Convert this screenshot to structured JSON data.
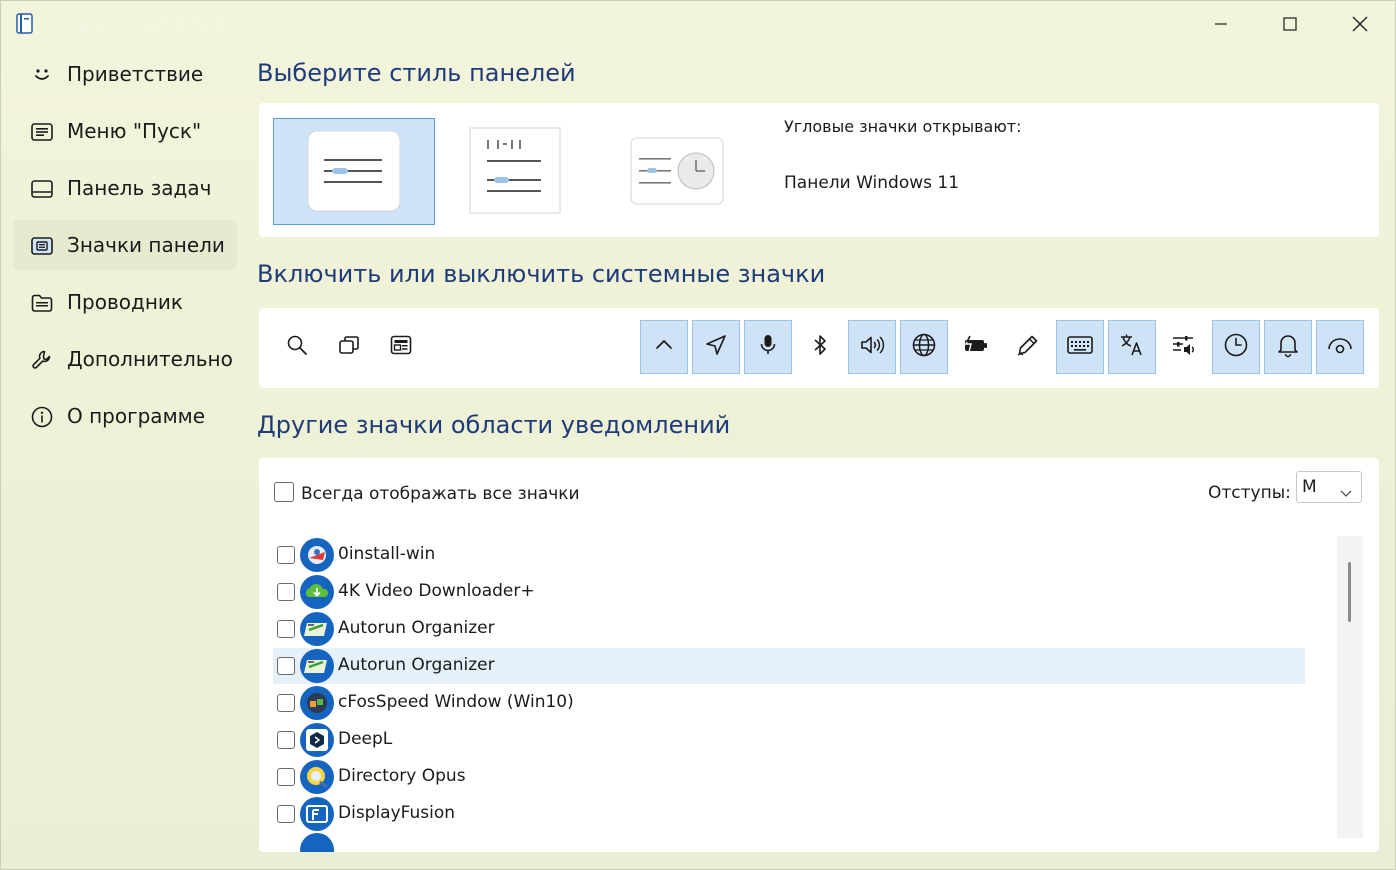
{
  "window": {
    "title": "Настройки StartAllBack",
    "controls": {
      "minimize": "minimize-icon",
      "maximize": "maximize-icon",
      "close": "close-icon"
    }
  },
  "sidebar": {
    "items": [
      {
        "label": "Приветствие",
        "icon": "smile-icon",
        "active": false
      },
      {
        "label": "Меню \"Пуск\"",
        "icon": "start-menu-icon",
        "active": false
      },
      {
        "label": "Панель задач",
        "icon": "taskbar-icon",
        "active": false
      },
      {
        "label": "Значки панели",
        "icon": "tray-icons-icon",
        "active": true
      },
      {
        "label": "Проводник",
        "icon": "folder-icon",
        "active": false
      },
      {
        "label": "Дополнительно",
        "icon": "wrench-icon",
        "active": false
      },
      {
        "label": "О программе",
        "icon": "info-icon",
        "active": false
      }
    ]
  },
  "panel_style": {
    "heading": "Выберите стиль панелей",
    "selected_index": 0,
    "corner_icons_label": "Угловые значки открывают:",
    "corner_icons_value": "Панели Windows 11"
  },
  "system_icons": {
    "heading": "Включить или выключить системные значки",
    "left_icons": [
      "search-icon",
      "task-view-icon",
      "widgets-icon"
    ],
    "right_icons": [
      {
        "name": "chevron-up-icon",
        "on": true
      },
      {
        "name": "location-icon",
        "on": true
      },
      {
        "name": "microphone-icon",
        "on": true
      },
      {
        "name": "bluetooth-icon",
        "on": false
      },
      {
        "name": "volume-icon",
        "on": true
      },
      {
        "name": "network-icon",
        "on": true
      },
      {
        "name": "battery-icon",
        "on": false
      },
      {
        "name": "pen-icon",
        "on": false
      },
      {
        "name": "keyboard-icon",
        "on": true
      },
      {
        "name": "language-icon",
        "on": true
      },
      {
        "name": "audio-settings-icon",
        "on": false
      },
      {
        "name": "clock-icon",
        "on": true
      },
      {
        "name": "bell-icon",
        "on": true
      },
      {
        "name": "eye-icon",
        "on": true
      }
    ]
  },
  "notification_icons": {
    "heading": "Другие значки области уведомлений",
    "always_show_label": "Всегда отображать все значки",
    "always_show_checked": false,
    "spacing_label": "Отступы:",
    "spacing_value": "M",
    "apps": [
      {
        "name": "0install-win",
        "checked": false,
        "hover": false
      },
      {
        "name": "4K Video Downloader+",
        "checked": false,
        "hover": false
      },
      {
        "name": "Autorun Organizer",
        "checked": false,
        "hover": false
      },
      {
        "name": "Autorun Organizer",
        "checked": false,
        "hover": true
      },
      {
        "name": "cFosSpeed Window (Win10)",
        "checked": false,
        "hover": false
      },
      {
        "name": "DeepL",
        "checked": false,
        "hover": false
      },
      {
        "name": "Directory Opus",
        "checked": false,
        "hover": false
      },
      {
        "name": "DisplayFusion",
        "checked": false,
        "hover": false
      }
    ]
  },
  "colors": {
    "accent": "#1f3b7a",
    "selected_bg": "#cfe3f8",
    "selected_border": "#5b9bd5",
    "app_icon_bg": "#1565c0"
  }
}
